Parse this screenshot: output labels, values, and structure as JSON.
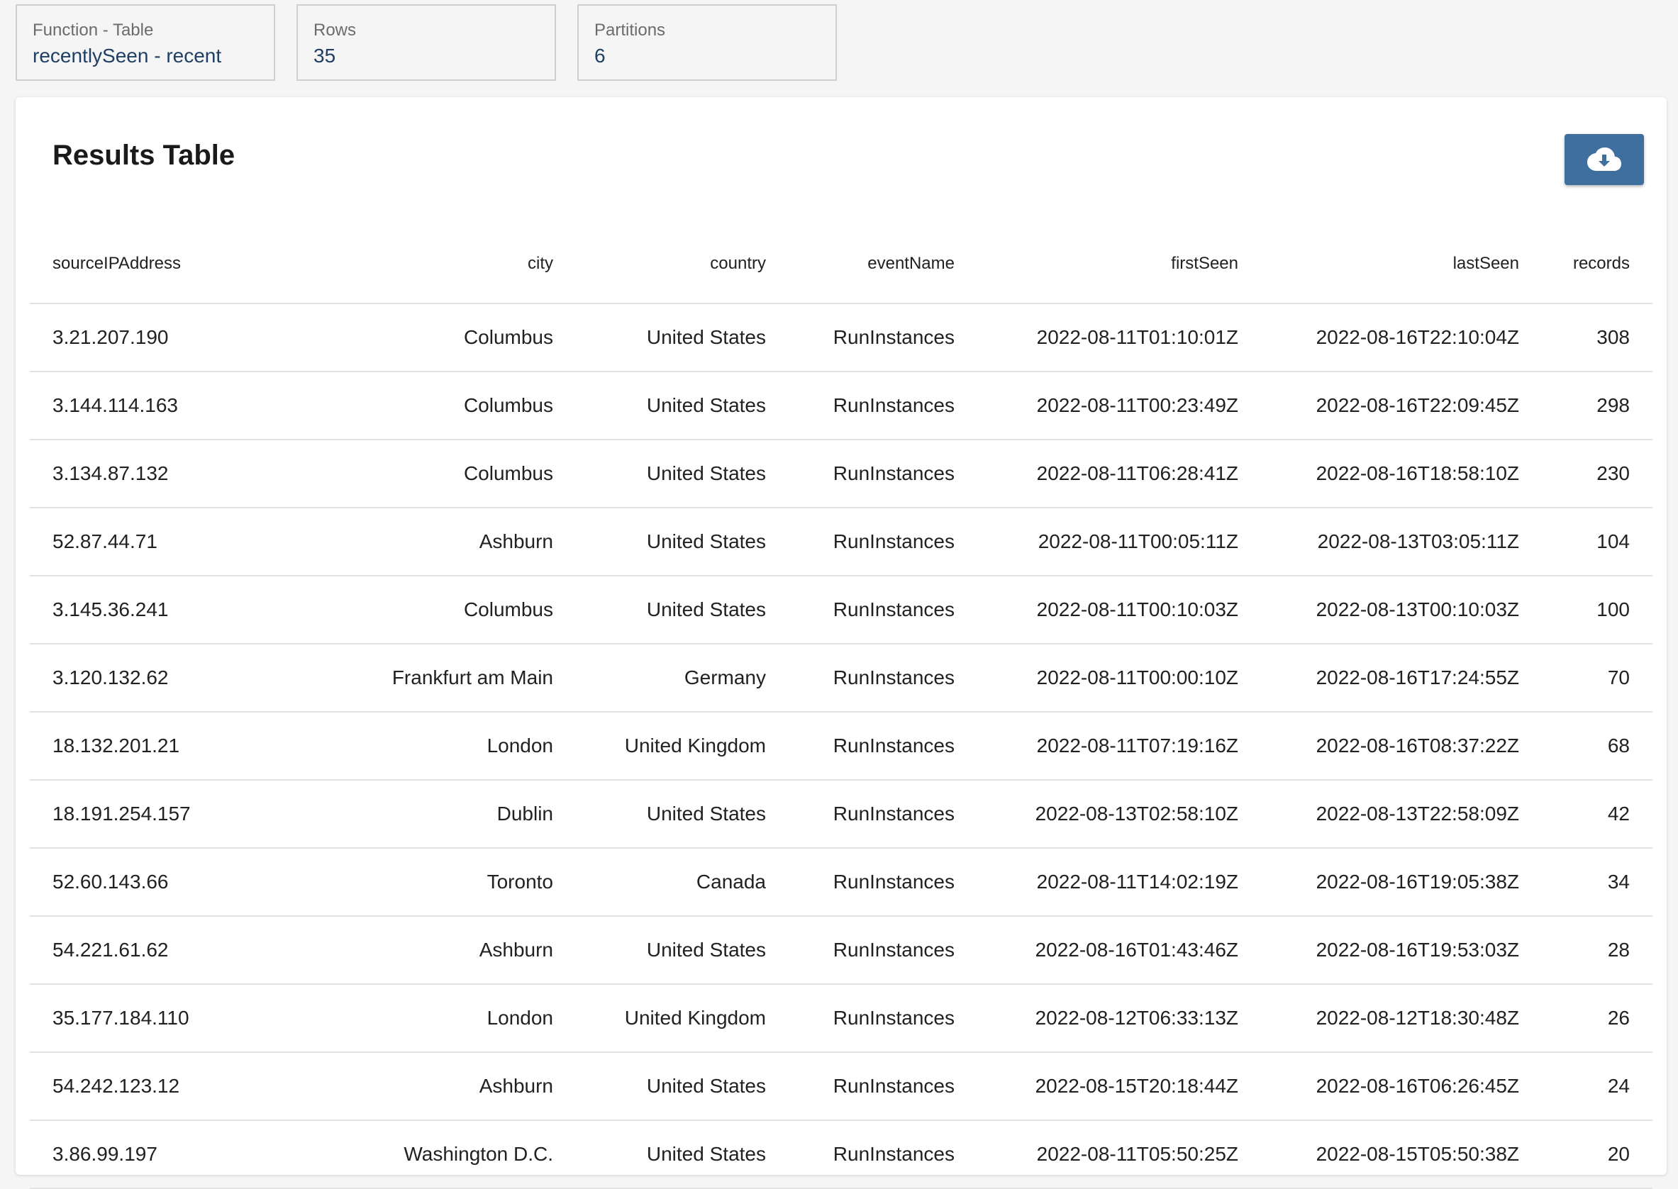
{
  "stats": [
    {
      "label": "Function - Table",
      "value": "recentlySeen - recent"
    },
    {
      "label": "Rows",
      "value": "35"
    },
    {
      "label": "Partitions",
      "value": "6"
    }
  ],
  "panel": {
    "title": "Results Table",
    "download_icon": "cloud-download-icon"
  },
  "table": {
    "columns": [
      "sourceIPAddress",
      "city",
      "country",
      "eventName",
      "firstSeen",
      "lastSeen",
      "records"
    ],
    "rows": [
      [
        "3.21.207.190",
        "Columbus",
        "United States",
        "RunInstances",
        "2022-08-11T01:10:01Z",
        "2022-08-16T22:10:04Z",
        "308"
      ],
      [
        "3.144.114.163",
        "Columbus",
        "United States",
        "RunInstances",
        "2022-08-11T00:23:49Z",
        "2022-08-16T22:09:45Z",
        "298"
      ],
      [
        "3.134.87.132",
        "Columbus",
        "United States",
        "RunInstances",
        "2022-08-11T06:28:41Z",
        "2022-08-16T18:58:10Z",
        "230"
      ],
      [
        "52.87.44.71",
        "Ashburn",
        "United States",
        "RunInstances",
        "2022-08-11T00:05:11Z",
        "2022-08-13T03:05:11Z",
        "104"
      ],
      [
        "3.145.36.241",
        "Columbus",
        "United States",
        "RunInstances",
        "2022-08-11T00:10:03Z",
        "2022-08-13T00:10:03Z",
        "100"
      ],
      [
        "3.120.132.62",
        "Frankfurt am Main",
        "Germany",
        "RunInstances",
        "2022-08-11T00:00:10Z",
        "2022-08-16T17:24:55Z",
        "70"
      ],
      [
        "18.132.201.21",
        "London",
        "United Kingdom",
        "RunInstances",
        "2022-08-11T07:19:16Z",
        "2022-08-16T08:37:22Z",
        "68"
      ],
      [
        "18.191.254.157",
        "Dublin",
        "United States",
        "RunInstances",
        "2022-08-13T02:58:10Z",
        "2022-08-13T22:58:09Z",
        "42"
      ],
      [
        "52.60.143.66",
        "Toronto",
        "Canada",
        "RunInstances",
        "2022-08-11T14:02:19Z",
        "2022-08-16T19:05:38Z",
        "34"
      ],
      [
        "54.221.61.62",
        "Ashburn",
        "United States",
        "RunInstances",
        "2022-08-16T01:43:46Z",
        "2022-08-16T19:53:03Z",
        "28"
      ],
      [
        "35.177.184.110",
        "London",
        "United Kingdom",
        "RunInstances",
        "2022-08-12T06:33:13Z",
        "2022-08-12T18:30:48Z",
        "26"
      ],
      [
        "54.242.123.12",
        "Ashburn",
        "United States",
        "RunInstances",
        "2022-08-15T20:18:44Z",
        "2022-08-16T06:26:45Z",
        "24"
      ],
      [
        "3.86.99.197",
        "Washington D.C.",
        "United States",
        "RunInstances",
        "2022-08-11T05:50:25Z",
        "2022-08-15T05:50:38Z",
        "20"
      ]
    ]
  },
  "colors": {
    "accent": "#3f6f9f",
    "stat_value": "#1f3f63"
  }
}
